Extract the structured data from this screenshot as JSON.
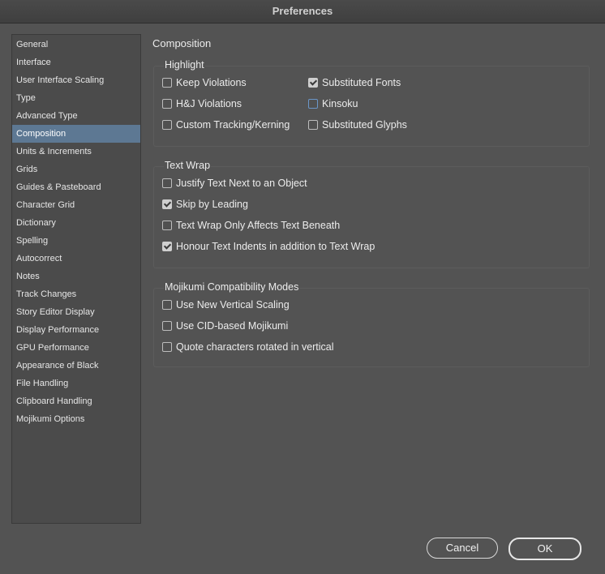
{
  "window": {
    "title": "Preferences"
  },
  "sidebar": {
    "selected_index": 5,
    "items": [
      {
        "label": "General"
      },
      {
        "label": "Interface"
      },
      {
        "label": "User Interface Scaling"
      },
      {
        "label": "Type"
      },
      {
        "label": "Advanced Type"
      },
      {
        "label": "Composition"
      },
      {
        "label": "Units & Increments"
      },
      {
        "label": "Grids"
      },
      {
        "label": "Guides & Pasteboard"
      },
      {
        "label": "Character Grid"
      },
      {
        "label": "Dictionary"
      },
      {
        "label": "Spelling"
      },
      {
        "label": "Autocorrect"
      },
      {
        "label": "Notes"
      },
      {
        "label": "Track Changes"
      },
      {
        "label": "Story Editor Display"
      },
      {
        "label": "Display Performance"
      },
      {
        "label": "GPU Performance"
      },
      {
        "label": "Appearance of Black"
      },
      {
        "label": "File Handling"
      },
      {
        "label": "Clipboard Handling"
      },
      {
        "label": "Mojikumi Options"
      }
    ]
  },
  "main": {
    "title": "Composition",
    "highlight": {
      "title": "Highlight",
      "options": [
        {
          "label": "Keep Violations",
          "checked": false
        },
        {
          "label": "H&J Violations",
          "checked": false
        },
        {
          "label": "Custom Tracking/Kerning",
          "checked": false
        },
        {
          "label": "Substituted Fonts",
          "checked": true
        },
        {
          "label": "Kinsoku",
          "checked": false
        },
        {
          "label": "Substituted Glyphs",
          "checked": false
        }
      ]
    },
    "text_wrap": {
      "title": "Text Wrap",
      "options": [
        {
          "label": "Justify Text Next to an Object",
          "checked": false
        },
        {
          "label": "Skip by Leading",
          "checked": true
        },
        {
          "label": "Text Wrap Only Affects Text Beneath",
          "checked": false
        },
        {
          "label": "Honour Text Indents in addition to Text Wrap",
          "checked": true
        }
      ]
    },
    "mojikumi": {
      "title": "Mojikumi Compatibility Modes",
      "options": [
        {
          "label": "Use New Vertical Scaling",
          "checked": false
        },
        {
          "label": "Use CID-based Mojikumi",
          "checked": false
        },
        {
          "label": "Quote characters rotated in vertical",
          "checked": false
        }
      ]
    }
  },
  "footer": {
    "cancel_label": "Cancel",
    "ok_label": "OK"
  }
}
